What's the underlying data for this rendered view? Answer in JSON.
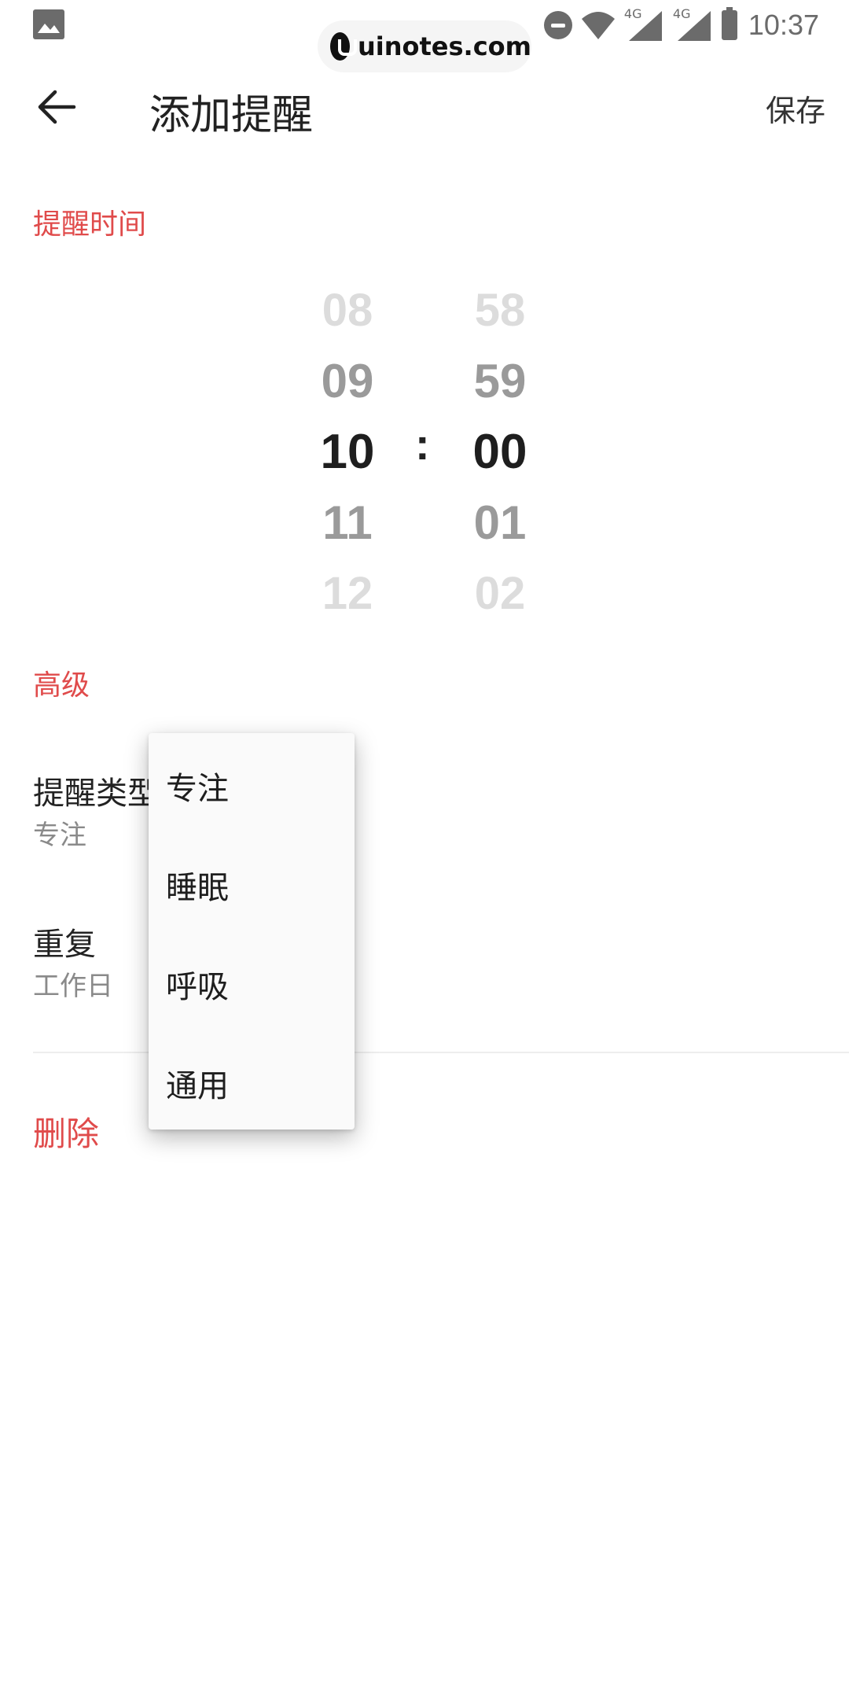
{
  "status_bar": {
    "time": "10:37",
    "network_tags": [
      "4G",
      "4G"
    ]
  },
  "watermark": {
    "text": "uinotes.com"
  },
  "app_bar": {
    "title": "添加提醒",
    "save_label": "保存"
  },
  "reminder_time": {
    "section_label": "提醒时间",
    "hours": [
      "08",
      "09",
      "10",
      "11",
      "12"
    ],
    "minutes": [
      "58",
      "59",
      "00",
      "01",
      "02"
    ],
    "separator": ":",
    "selected_hour": "10",
    "selected_minute": "00"
  },
  "advanced": {
    "section_label": "高级",
    "reminder_type": {
      "title": "提醒类型",
      "value": "专注"
    },
    "repeat": {
      "title": "重复",
      "value": "工作日"
    },
    "delete_label": "删除"
  },
  "dropdown": {
    "options": [
      "专注",
      "睡眠",
      "呼吸",
      "通用"
    ]
  }
}
